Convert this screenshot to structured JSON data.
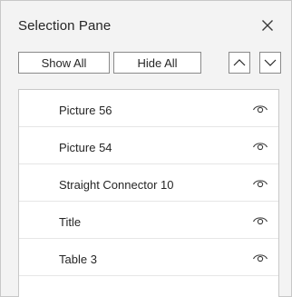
{
  "pane": {
    "title": "Selection Pane",
    "close_icon": "close-icon"
  },
  "toolbar": {
    "show_all_label": "Show All",
    "hide_all_label": "Hide All",
    "bring_forward_icon": "chevron-up-icon",
    "send_backward_icon": "chevron-down-icon"
  },
  "items": [
    {
      "label": "Picture 56",
      "visibility_icon": "eye-icon"
    },
    {
      "label": "Picture 54",
      "visibility_icon": "eye-icon"
    },
    {
      "label": "Straight Connector 10",
      "visibility_icon": "eye-icon"
    },
    {
      "label": "Title",
      "visibility_icon": "eye-icon"
    },
    {
      "label": "Table 3",
      "visibility_icon": "eye-icon"
    }
  ],
  "colors": {
    "pane_background": "#f3f3f3",
    "list_background": "#ffffff",
    "text": "#262626",
    "border": "#8a8a8a"
  }
}
